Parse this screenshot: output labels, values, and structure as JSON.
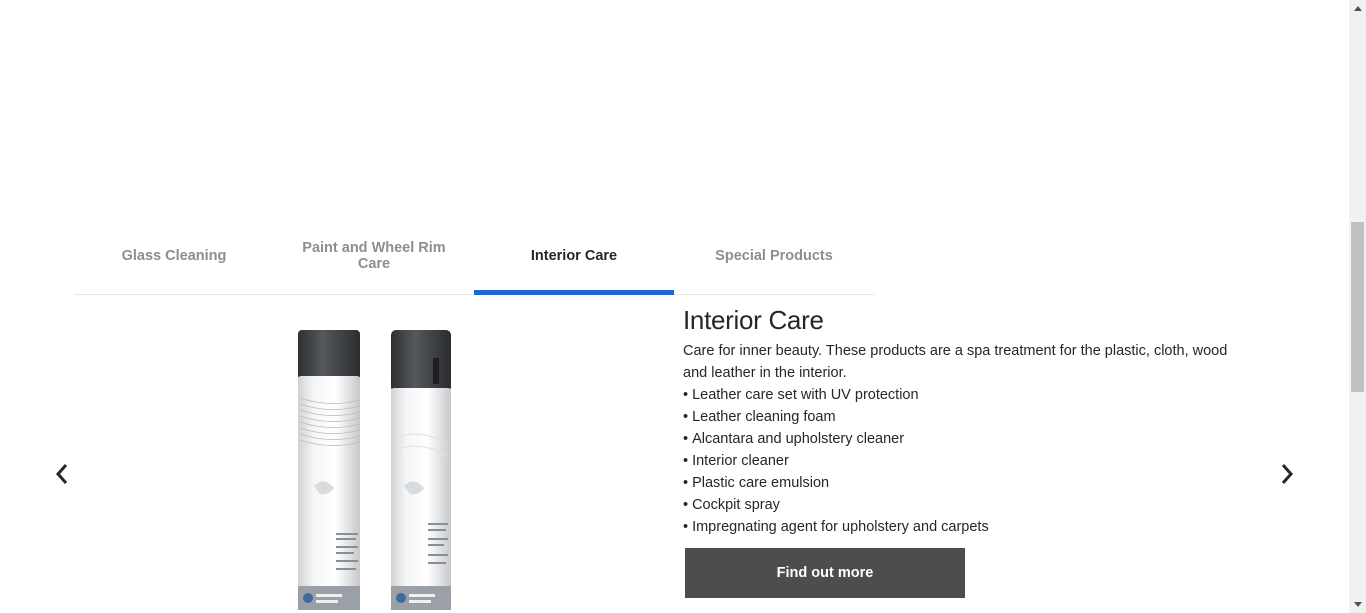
{
  "tabs": [
    {
      "label": "Glass Cleaning",
      "active": false
    },
    {
      "label": "Paint and Wheel Rim Care",
      "active": false
    },
    {
      "label": "Interior Care",
      "active": true
    },
    {
      "label": "Special Products",
      "active": false
    }
  ],
  "panel": {
    "title": "Interior Care",
    "description": "Care for inner beauty. These products are a spa treatment for the plastic, cloth, wood and leather in the interior.",
    "items": [
      "Leather care set with UV protection",
      "Leather cleaning foam",
      "Alcantara and upholstery cleaner",
      "Interior cleaner",
      "Plastic care emulsion",
      "Cockpit spray",
      "Impregnating agent for upholstery and carpets"
    ],
    "cta_label": "Find out more"
  },
  "icons": {
    "prev": "chevron-left-icon",
    "next": "chevron-right-icon"
  },
  "colors": {
    "accent": "#1c69d4",
    "button": "#4d4d4d",
    "text": "#262626",
    "inactive_tab": "#8e8e8e"
  }
}
